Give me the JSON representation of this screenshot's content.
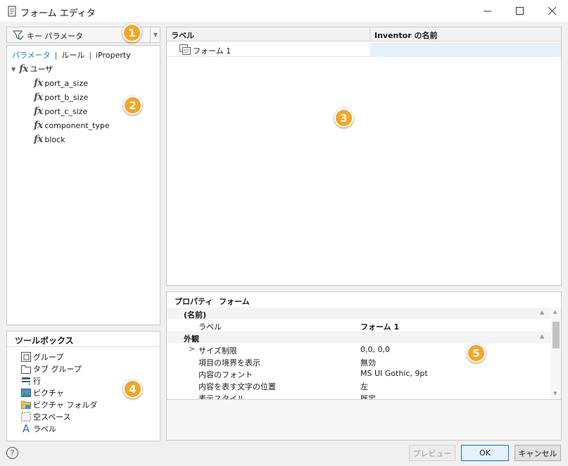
{
  "window": {
    "title": "フォーム エディタ",
    "minimize_icon": "minimize-icon",
    "maximize_icon": "maximize-icon",
    "close_icon": "close-icon"
  },
  "param_combo": {
    "label": "キー パラメータ"
  },
  "left_tabs": {
    "params": "パラメータ",
    "rules": "ルール",
    "iproperty": "iProperty",
    "separator": "|"
  },
  "tree": {
    "root": "ユーザ",
    "items": [
      "port_a_size",
      "port_b_size",
      "port_c_size",
      "component_type",
      "block"
    ]
  },
  "toolbox": {
    "title": "ツールボックス",
    "items": [
      "グループ",
      "タブ グループ",
      "行",
      "ピクチャ",
      "ピクチャ フォルダ",
      "空スペース",
      "ラベル"
    ]
  },
  "grid": {
    "col_label": "ラベル",
    "col_name": "Inventor の名前",
    "row_label": "フォーム 1"
  },
  "properties": {
    "tab_props": "プロパティ",
    "tab_form": "フォーム",
    "rows": [
      {
        "type": "category",
        "key": "(名前)",
        "value": ""
      },
      {
        "type": "item",
        "key": "ラベル",
        "value": "フォーム 1"
      },
      {
        "type": "category",
        "key": "外観",
        "value": ""
      },
      {
        "type": "item",
        "key": "サイズ制限",
        "value": "0,0, 0,0",
        "expand": ">"
      },
      {
        "type": "item",
        "key": "項目の境界を表示",
        "value": "無効"
      },
      {
        "type": "item",
        "key": "内容のフォント",
        "value": "MS UI Gothic, 9pt"
      },
      {
        "type": "item",
        "key": "内容を表す文字の位置",
        "value": "左"
      },
      {
        "type": "item",
        "key": "表示スタイル",
        "value": "既定"
      }
    ]
  },
  "buttons": {
    "preview": "プレビュー",
    "ok": "OK",
    "cancel": "キャンセル",
    "help": "?"
  },
  "callouts": [
    "1",
    "2",
    "3",
    "4",
    "5"
  ],
  "colors": {
    "accent": "#1b7fc4",
    "callout": "#f5a623",
    "selection": "#e6f2fb"
  }
}
